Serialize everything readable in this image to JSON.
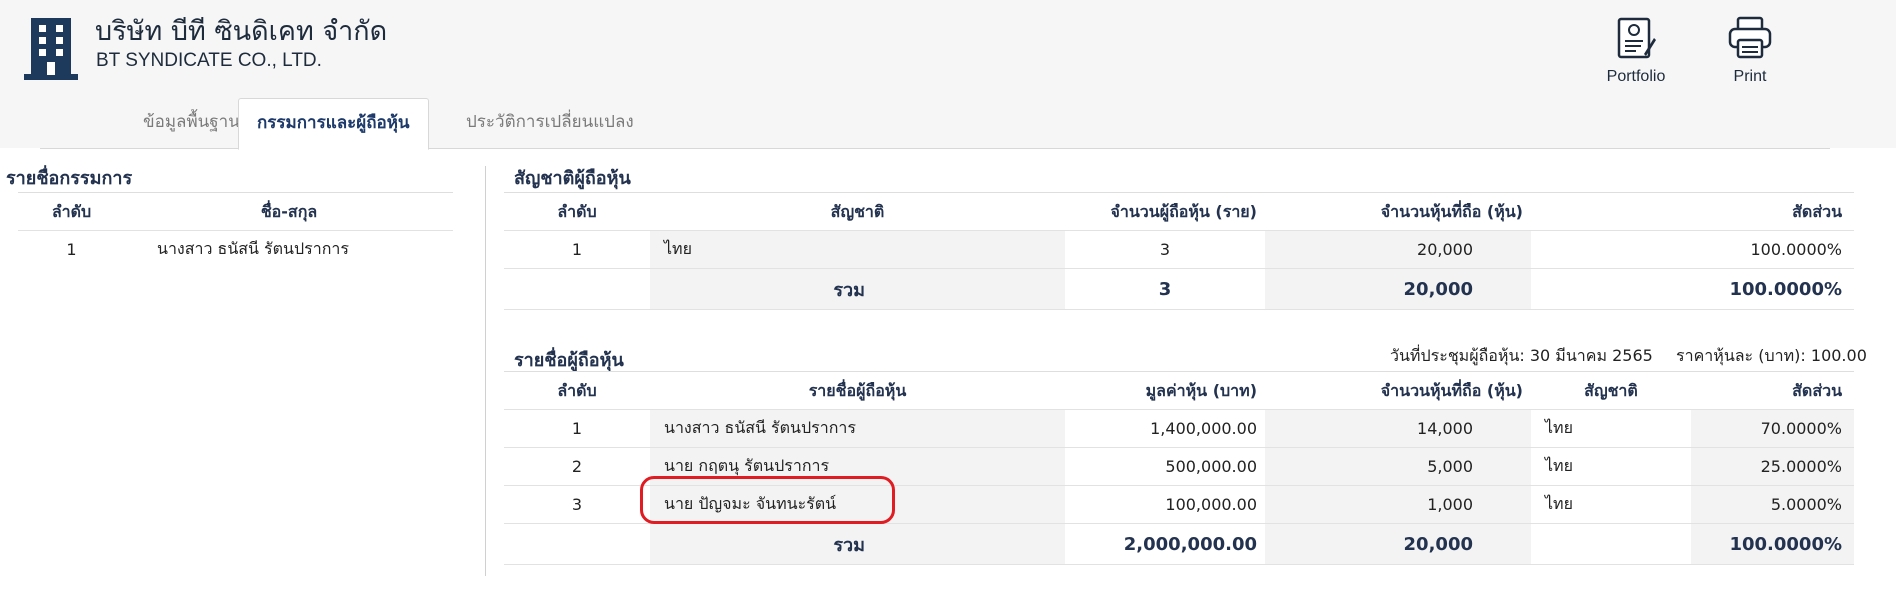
{
  "company": {
    "name_th": "บริษัท บีที ซินดิเคท จำกัด",
    "name_en": "BT SYNDICATE CO., LTD."
  },
  "actions": {
    "portfolio": "Portfolio",
    "print": "Print"
  },
  "tabs": [
    {
      "label": "ข้อมูลพื้นฐาน",
      "active": false
    },
    {
      "label": "กรรมการและผู้ถือหุ้น",
      "active": true
    },
    {
      "label": "ประวัติการเปลี่ยนแปลง",
      "active": false
    }
  ],
  "directors": {
    "title": "รายชื่อกรรมการ",
    "headers": [
      "ลำดับ",
      "ชื่อ-สกุล"
    ],
    "rows": [
      {
        "no": "1",
        "name": "นางสาว ธนัสนี รัตนปราการ"
      }
    ]
  },
  "nationality": {
    "title": "สัญชาติผู้ถือหุ้น",
    "headers": [
      "ลำดับ",
      "สัญชาติ",
      "จำนวนผู้ถือหุ้น (ราย)",
      "จำนวนหุ้นที่ถือ (หุ้น)",
      "สัดส่วน"
    ],
    "rows": [
      {
        "no": "1",
        "nationality": "ไทย",
        "holders": "3",
        "shares": "20,000",
        "ratio": "100.0000%"
      }
    ],
    "total": {
      "label": "รวม",
      "holders": "3",
      "shares": "20,000",
      "ratio": "100.0000%"
    }
  },
  "shareholders": {
    "title": "รายชื่อผู้ถือหุ้น",
    "meeting_date": "วันที่ประชุมผู้ถือหุ้น: 30 มีนาคม 2565",
    "par_value": "ราคาหุ้นละ (บาท): 100.00",
    "headers": [
      "ลำดับ",
      "รายชื่อผู้ถือหุ้น",
      "มูลค่าหุ้น (บาท)",
      "จำนวนหุ้นที่ถือ (หุ้น)",
      "สัญชาติ",
      "สัดส่วน"
    ],
    "rows": [
      {
        "no": "1",
        "name": "นางสาว ธนัสนี รัตนปราการ",
        "value": "1,400,000.00",
        "shares": "14,000",
        "nationality": "ไทย",
        "ratio": "70.0000%"
      },
      {
        "no": "2",
        "name": "นาย กฤตนุ รัตนปราการ",
        "value": "500,000.00",
        "shares": "5,000",
        "nationality": "ไทย",
        "ratio": "25.0000%"
      },
      {
        "no": "3",
        "name": "นาย ปัญจมะ จันทนะรัตน์",
        "value": "100,000.00",
        "shares": "1,000",
        "nationality": "ไทย",
        "ratio": "5.0000%"
      }
    ],
    "total": {
      "label": "รวม",
      "value": "2,000,000.00",
      "shares": "20,000",
      "ratio": "100.0000%"
    }
  },
  "colors": {
    "highlight": "#e11b22",
    "heading": "#22324f"
  }
}
